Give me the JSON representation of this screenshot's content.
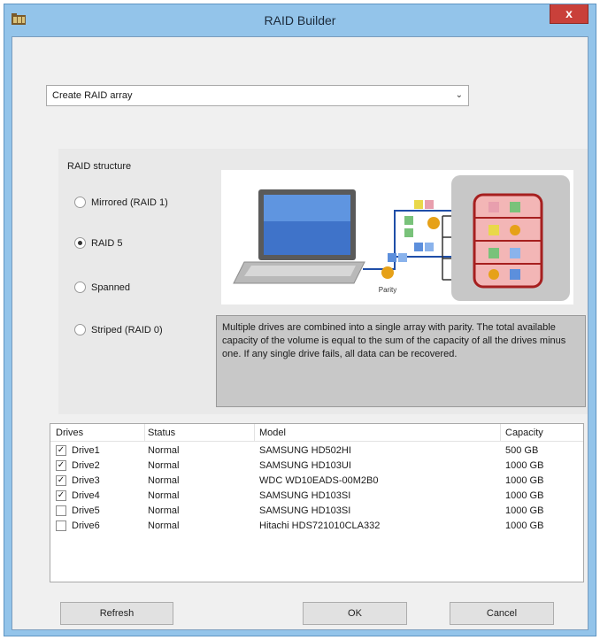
{
  "window": {
    "title": "RAID Builder",
    "close_label": "x"
  },
  "action_combo": {
    "value": "Create RAID array"
  },
  "structure": {
    "label": "RAID structure",
    "options": [
      {
        "label": "Mirrored (RAID 1)",
        "checked": false
      },
      {
        "label": "RAID 5",
        "checked": true
      },
      {
        "label": "Spanned",
        "checked": false
      },
      {
        "label": "Striped (RAID 0)",
        "checked": false
      }
    ],
    "diagram_parity_label": "Parity",
    "description": "Multiple drives are combined into a single array with parity. The total available capacity of the volume is equal to the sum of the capacity of all the drives minus one. If any single drive fails, all data can be recovered."
  },
  "drives_table": {
    "headers": [
      "Drives",
      "Status",
      "Model",
      "Capacity"
    ],
    "rows": [
      {
        "checked": true,
        "drive": "Drive1",
        "status": "Normal",
        "model": "SAMSUNG HD502HI",
        "capacity": "500 GB"
      },
      {
        "checked": true,
        "drive": "Drive2",
        "status": "Normal",
        "model": "SAMSUNG HD103UI",
        "capacity": "1000 GB"
      },
      {
        "checked": true,
        "drive": "Drive3",
        "status": "Normal",
        "model": "WDC WD10EADS-00M2B0",
        "capacity": "1000 GB"
      },
      {
        "checked": true,
        "drive": "Drive4",
        "status": "Normal",
        "model": "SAMSUNG HD103SI",
        "capacity": "1000 GB"
      },
      {
        "checked": false,
        "drive": "Drive5",
        "status": "Normal",
        "model": "SAMSUNG HD103SI",
        "capacity": "1000 GB"
      },
      {
        "checked": false,
        "drive": "Drive6",
        "status": "Normal",
        "model": "Hitachi HDS721010CLA332",
        "capacity": "1000 GB"
      }
    ]
  },
  "buttons": {
    "refresh": "Refresh",
    "ok": "OK",
    "cancel": "Cancel"
  },
  "colors": {
    "title_bar": "#93c4ea",
    "close_button": "#c9403a",
    "description_bg": "#c8c8c8"
  }
}
